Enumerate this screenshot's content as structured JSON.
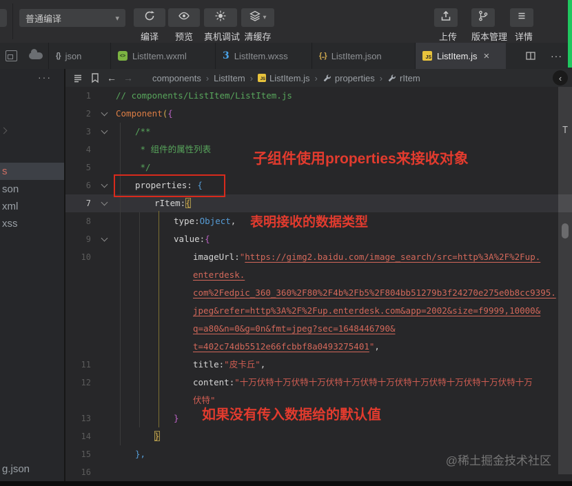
{
  "toolbar": {
    "compile_mode": "普通编译",
    "actions": [
      {
        "label": "编译",
        "icon": "refresh-icon"
      },
      {
        "label": "预览",
        "icon": "eye-icon"
      },
      {
        "label": "真机调试",
        "icon": "bug-icon"
      },
      {
        "label": "清缓存",
        "icon": "layers-icon",
        "has_caret": true
      }
    ],
    "right_actions": [
      {
        "label": "上传",
        "icon": "upload-icon"
      },
      {
        "label": "版本管理",
        "icon": "branch-icon"
      },
      {
        "label": "详情",
        "icon": "menu-icon"
      }
    ]
  },
  "tabbar": {
    "tabs": [
      {
        "label": "json",
        "icon": "json-doc-icon",
        "active": false
      },
      {
        "label": "ListItem.wxml",
        "icon": "wxml-icon",
        "active": false
      },
      {
        "label": "ListItem.wxss",
        "icon": "wxss-icon",
        "active": false
      },
      {
        "label": "ListItem.json",
        "icon": "braces-icon",
        "active": false
      },
      {
        "label": "ListItem.js",
        "icon": "js-icon",
        "active": true,
        "closable": true
      }
    ],
    "close_label": "×",
    "more_label": "···"
  },
  "breadcrumb": {
    "separator": "›",
    "items": [
      {
        "label": "components"
      },
      {
        "label": "ListItem"
      },
      {
        "label": "ListItem.js",
        "icon": "js-icon"
      },
      {
        "label": "properties",
        "icon": "wrench-icon"
      },
      {
        "label": "rItem",
        "icon": "wrench-icon"
      }
    ],
    "collapse_label": "‹"
  },
  "sidebar": {
    "more_label": "···",
    "rows": [
      {
        "label": "s",
        "selected": true
      },
      {
        "label": "son",
        "selected": false
      },
      {
        "label": "xml",
        "selected": false
      },
      {
        "label": "xss",
        "selected": false
      }
    ],
    "bottom_item": "g.json"
  },
  "editor": {
    "scrollbar_letter": "T",
    "lines": [
      {
        "num": 1,
        "indent": 0,
        "rows": [
          [
            {
              "t": "// components/ListItem/ListItem.js",
              "c": "comment"
            }
          ]
        ]
      },
      {
        "num": 2,
        "indent": 0,
        "fold": true,
        "rows": [
          [
            {
              "t": "Component",
              "c": "func"
            },
            {
              "t": "(",
              "c": "b-gold"
            },
            {
              "t": "{",
              "c": "b-purple"
            }
          ]
        ]
      },
      {
        "num": 3,
        "indent": 1,
        "fold": true,
        "rows": [
          [
            {
              "t": "/**",
              "c": "comment"
            }
          ]
        ]
      },
      {
        "num": 4,
        "indent": 1,
        "rows": [
          [
            {
              "t": " * 组件的属性列表",
              "c": "comment"
            }
          ]
        ]
      },
      {
        "num": 5,
        "indent": 1,
        "rows": [
          [
            {
              "t": " */",
              "c": "comment"
            }
          ]
        ]
      },
      {
        "num": 6,
        "indent": 1,
        "fold": true,
        "rows": [
          [
            {
              "t": "properties",
              "c": "key"
            },
            {
              "t": ": ",
              "c": "plain"
            },
            {
              "t": "{",
              "c": "b-blue"
            }
          ]
        ]
      },
      {
        "num": 7,
        "indent": 2,
        "fold": true,
        "current": true,
        "rows": [
          [
            {
              "t": "rItem",
              "c": "key"
            },
            {
              "t": ":",
              "c": "plain"
            },
            {
              "t": "{",
              "c": "b-gold match"
            }
          ]
        ]
      },
      {
        "num": 8,
        "indent": 3,
        "rows": [
          [
            {
              "t": "type",
              "c": "key"
            },
            {
              "t": ":",
              "c": "plain"
            },
            {
              "t": "Object",
              "c": "type"
            },
            {
              "t": ",",
              "c": "plain"
            }
          ]
        ]
      },
      {
        "num": 9,
        "indent": 3,
        "fold": true,
        "rows": [
          [
            {
              "t": "value",
              "c": "key"
            },
            {
              "t": ":",
              "c": "plain"
            },
            {
              "t": "{",
              "c": "b-purple"
            }
          ]
        ]
      },
      {
        "num": 10,
        "indent": 4,
        "rows": [
          [
            {
              "t": "imageUrl",
              "c": "key"
            },
            {
              "t": ":",
              "c": "plain"
            },
            {
              "t": "\"",
              "c": "str"
            },
            {
              "t": "https://gimg2.baidu.com/image_search/src=http%3A%2F%2Fup.",
              "c": "link"
            }
          ],
          [
            {
              "t": "enterdesk.",
              "c": "link"
            }
          ],
          [
            {
              "t": "com%2Fedpic_360_360%2F80%2F4b%2Fb5%2F804bb51279b3f24270e275e0b8cc9395.",
              "c": "link"
            }
          ],
          [
            {
              "t": "jpeg&refer=http%3A%2F%2Fup.enterdesk.com&app=2002&size=f9999,10000&",
              "c": "link"
            }
          ],
          [
            {
              "t": "q=a80&n=0&g=0n&fmt=jpeg?sec=1648446790&",
              "c": "link"
            }
          ],
          [
            {
              "t": "t=402c74db5512e66fcbbf8a0493275401",
              "c": "link"
            },
            {
              "t": "\"",
              "c": "str"
            },
            {
              "t": ",",
              "c": "plain"
            }
          ]
        ]
      },
      {
        "num": 11,
        "indent": 4,
        "rows": [
          [
            {
              "t": "title",
              "c": "key"
            },
            {
              "t": ":",
              "c": "plain"
            },
            {
              "t": "\"皮卡丘\"",
              "c": "str"
            },
            {
              "t": ",",
              "c": "plain"
            }
          ]
        ]
      },
      {
        "num": 12,
        "indent": 4,
        "rows": [
          [
            {
              "t": "content",
              "c": "key"
            },
            {
              "t": ":",
              "c": "plain"
            },
            {
              "t": "\"十万伏特十万伏特十万伏特十万伏特十万伏特十万伏特十万伏特十万伏特十万",
              "c": "str"
            }
          ],
          [
            {
              "t": "伏特\"",
              "c": "str"
            }
          ]
        ]
      },
      {
        "num": 13,
        "indent": 3,
        "rows": [
          [
            {
              "t": "}",
              "c": "b-purple"
            }
          ]
        ]
      },
      {
        "num": 14,
        "indent": 2,
        "rows": [
          [
            {
              "t": "}",
              "c": "b-gold match"
            }
          ]
        ]
      },
      {
        "num": 15,
        "indent": 1,
        "rows": [
          [
            {
              "t": "},",
              "c": "b-blue"
            }
          ]
        ]
      },
      {
        "num": 16,
        "indent": 0,
        "rows": [
          []
        ]
      }
    ]
  },
  "annotations": {
    "note1": "子组件使用properties来接收对象",
    "note2": "表明接收的数据类型",
    "note3": "如果没有传入数据给的默认值"
  },
  "watermark": "@稀土掘金技术社区",
  "colors": {
    "accent_green": "#1fc75f",
    "annotation_red": "#e23b2e",
    "string_red": "#cf5d52"
  }
}
